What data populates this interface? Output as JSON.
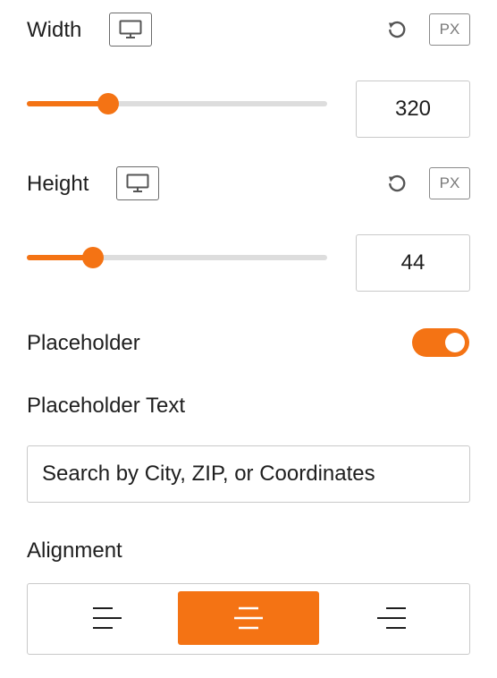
{
  "width": {
    "label": "Width",
    "device_icon": "desktop-icon",
    "reset_icon": "reset-icon",
    "unit": "PX",
    "value": "320",
    "slider_fraction": 0.27
  },
  "height": {
    "label": "Height",
    "device_icon": "desktop-icon",
    "reset_icon": "reset-icon",
    "unit": "PX",
    "value": "44",
    "slider_fraction": 0.22
  },
  "placeholder_toggle": {
    "label": "Placeholder",
    "enabled": true
  },
  "placeholder_text": {
    "label": "Placeholder Text",
    "value": "Search by City, ZIP, or Coordinates"
  },
  "alignment": {
    "label": "Alignment",
    "options": [
      "align-left-icon",
      "align-center-icon",
      "align-right-icon"
    ],
    "selected": "align-center-icon"
  },
  "colors": {
    "accent": "#f47314",
    "track": "#dddddd",
    "border": "#c9c9c9"
  }
}
